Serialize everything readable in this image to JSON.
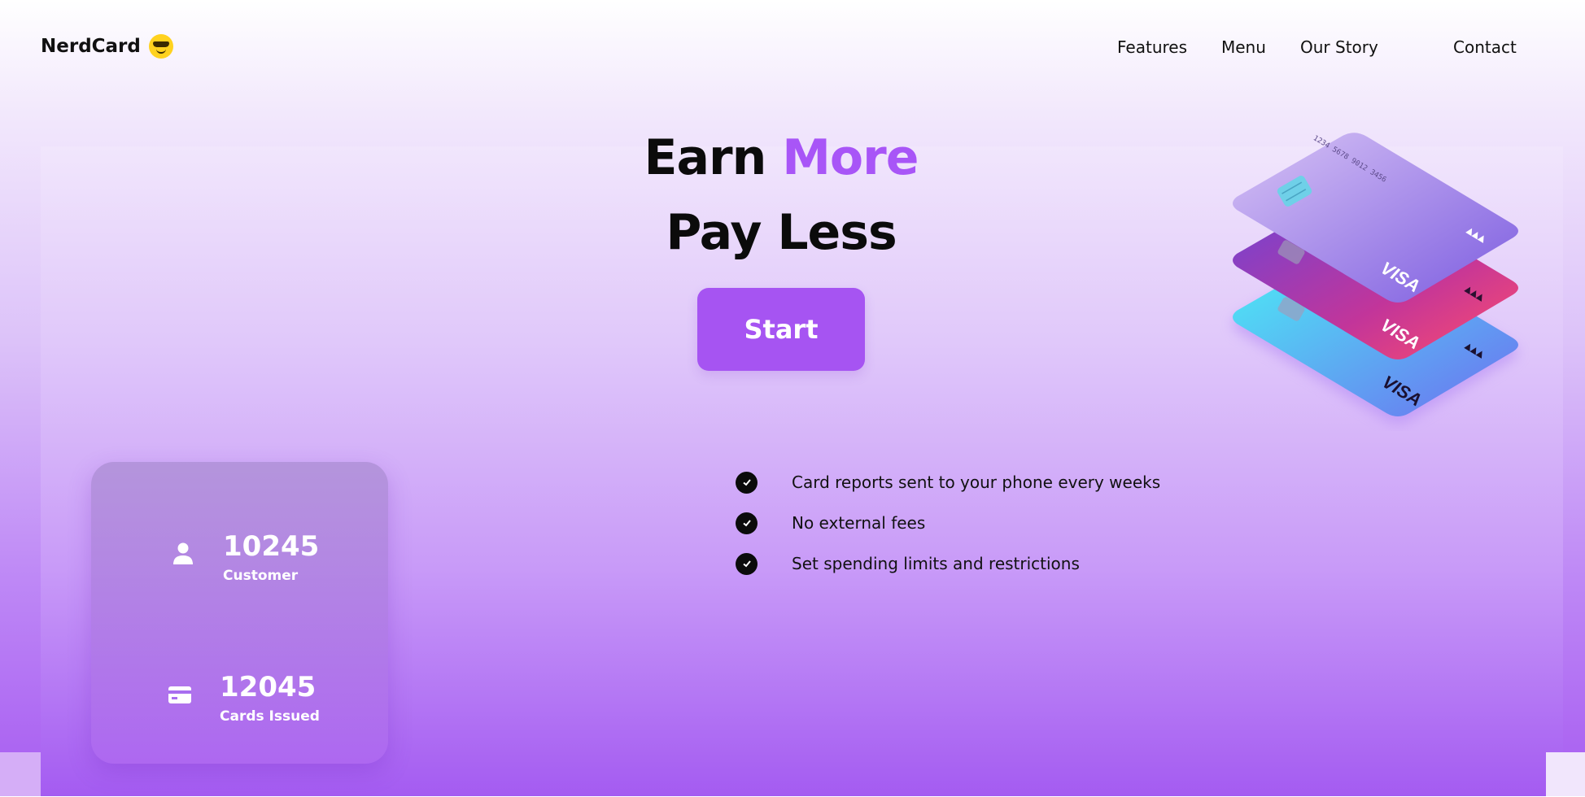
{
  "header": {
    "logo": "NerdCard",
    "nav": [
      "Features",
      "Menu",
      "Our Story",
      "Contact"
    ]
  },
  "hero": {
    "headline_word1": "Earn",
    "headline_accent": "More",
    "headline_line2": "Pay Less",
    "cta_label": "Start"
  },
  "features": [
    "Card reports sent to your phone every weeks",
    "No external fees",
    "Set spending limits and restrictions"
  ],
  "stats": [
    {
      "value": "10245",
      "label": "Customer",
      "icon": "user-icon"
    },
    {
      "value": "12045",
      "label": "Cards Issued",
      "icon": "credit-card-icon"
    }
  ],
  "cards": {
    "number": "1234 5678 9012 3456",
    "brand": "VISA"
  },
  "colors": {
    "accent": "#a855f7",
    "button": "#a654f2",
    "text": "#111111"
  }
}
